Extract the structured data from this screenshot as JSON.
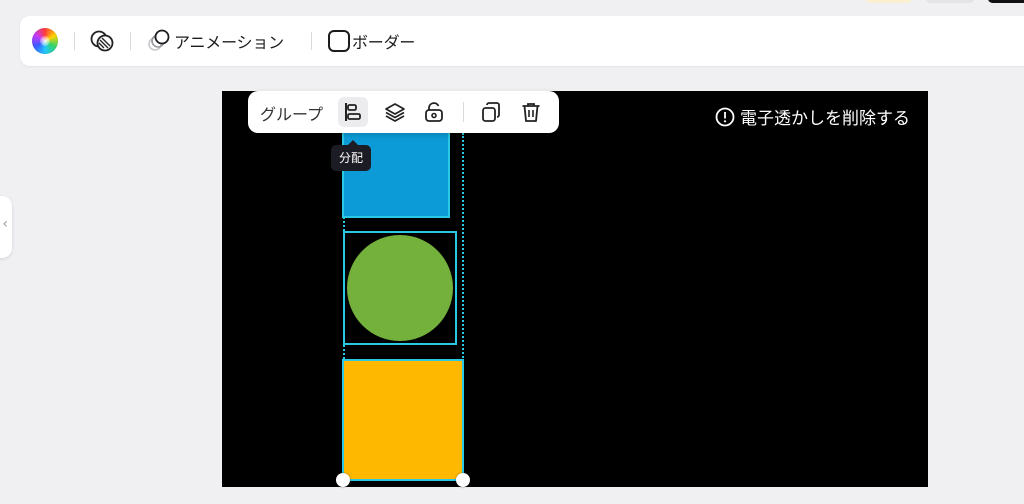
{
  "toolbar": {
    "color_icon": "color-wheel-icon",
    "transparency_icon": "transparency-icon",
    "animation_label": "アニメーション",
    "border_label": "ボーダー"
  },
  "context_toolbar": {
    "group_label": "グループ",
    "distribute_tooltip": "分配",
    "icons": [
      "distribute-icon",
      "layers-icon",
      "unlock-icon",
      "duplicate-icon",
      "trash-icon"
    ]
  },
  "canvas": {
    "watermark_label": "電子透かしを削除する",
    "shapes": [
      {
        "type": "square",
        "color": "#0d9bd7"
      },
      {
        "type": "circle",
        "color": "#74b03c"
      },
      {
        "type": "square",
        "color": "#ffb800"
      }
    ],
    "selection_color": "#29c8e4"
  }
}
